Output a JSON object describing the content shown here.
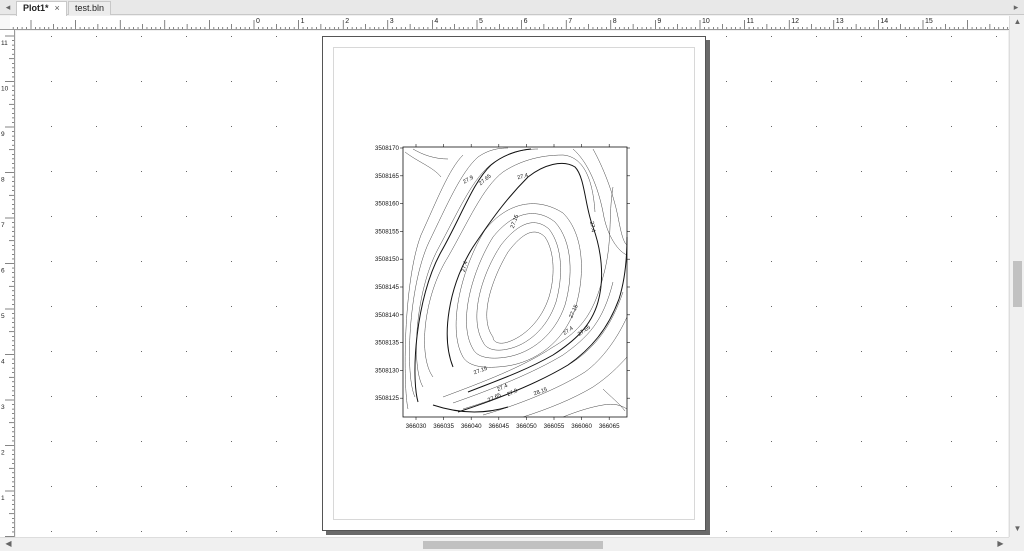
{
  "tabs": [
    {
      "label": "Plot1*",
      "active": true,
      "close": "×"
    },
    {
      "label": "test.bln",
      "active": false
    }
  ],
  "rulers": {
    "horizontal_labels": [
      "0",
      "1",
      "2",
      "3",
      "4",
      "5",
      "6",
      "7",
      "8",
      "9",
      "10",
      "11",
      "12",
      "13",
      "14",
      "15"
    ],
    "vertical_labels": [
      "11",
      "10",
      "9",
      "8",
      "7",
      "6",
      "5",
      "4",
      "3",
      "2",
      "1"
    ]
  },
  "plot": {
    "x_tick_labels": [
      "366030",
      "366035",
      "366040",
      "366045",
      "366050",
      "366055",
      "366060",
      "366065"
    ],
    "y_tick_labels": [
      "3508170",
      "3508165",
      "3508160",
      "3508155",
      "3508150",
      "3508145",
      "3508140",
      "3508135",
      "3508130",
      "3508125"
    ],
    "contour_labels": [
      "27.9",
      "27.65",
      "27.4",
      "27.15",
      "27.4",
      "27.4",
      "27.15",
      "27.4",
      "27.65",
      "27.15",
      "27.4",
      "27.65",
      "27.9",
      "28.15"
    ]
  },
  "icons": {
    "tab_left": "triangle-left-icon",
    "tab_right": "triangle-right-icon",
    "scroll_up": "arrow-up-icon",
    "scroll_down": "arrow-down-icon",
    "scroll_left": "arrow-left-icon",
    "scroll_right": "arrow-right-icon"
  }
}
